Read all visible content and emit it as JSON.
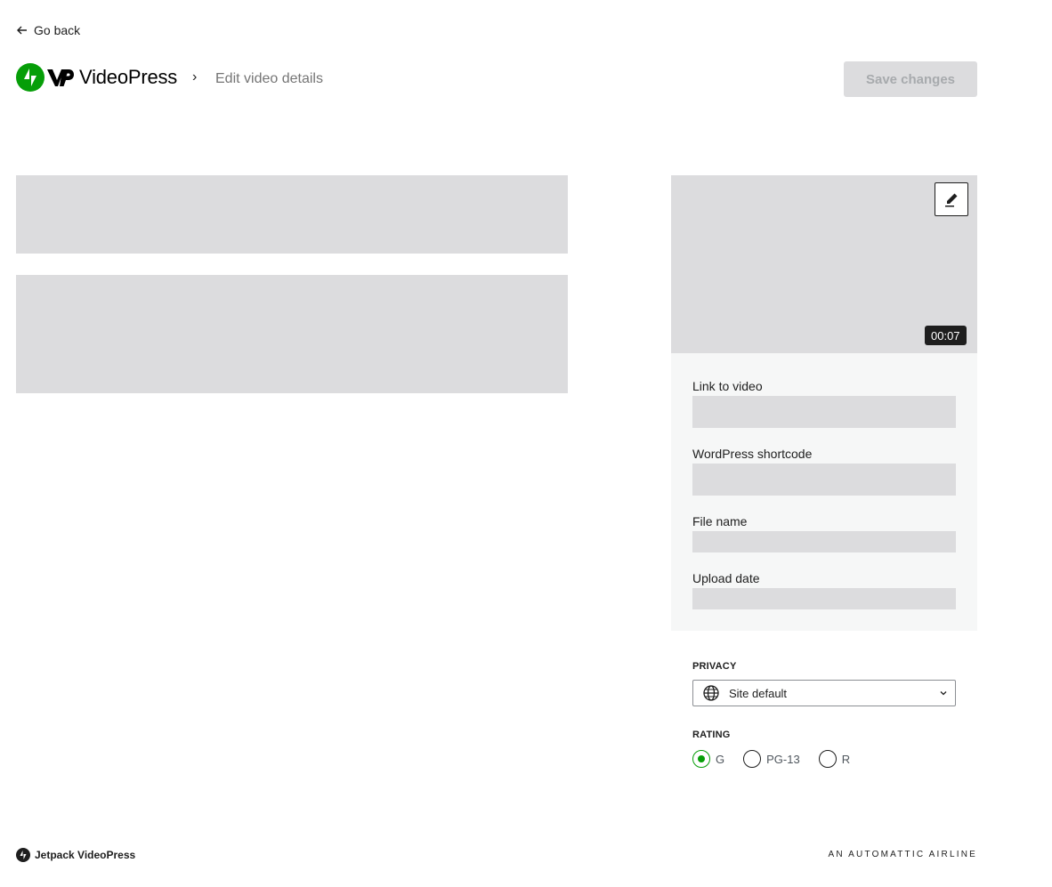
{
  "nav": {
    "go_back_label": "Go back"
  },
  "header": {
    "brand_name": "VideoPress",
    "breadcrumb_separator": "›",
    "page_title": "Edit video details",
    "save_label": "Save changes"
  },
  "thumbnail": {
    "duration": "00:07"
  },
  "details": {
    "link_label": "Link to video",
    "shortcode_label": "WordPress shortcode",
    "filename_label": "File name",
    "upload_date_label": "Upload date"
  },
  "privacy": {
    "section_label": "PRIVACY",
    "selected_value": "Site default",
    "icon": "globe-icon"
  },
  "rating": {
    "section_label": "RATING",
    "options": [
      {
        "label": "G",
        "checked": true
      },
      {
        "label": "PG-13",
        "checked": false
      },
      {
        "label": "R",
        "checked": false
      }
    ]
  },
  "footer": {
    "product_name": "Jetpack VideoPress",
    "tagline": "AN AUTOMATTIC AIRLINE"
  },
  "colors": {
    "brand_green": "#069e08",
    "skeleton": "#dcdcde",
    "panel_bg": "#f6f7f7",
    "disabled_text": "#a7aaad"
  }
}
